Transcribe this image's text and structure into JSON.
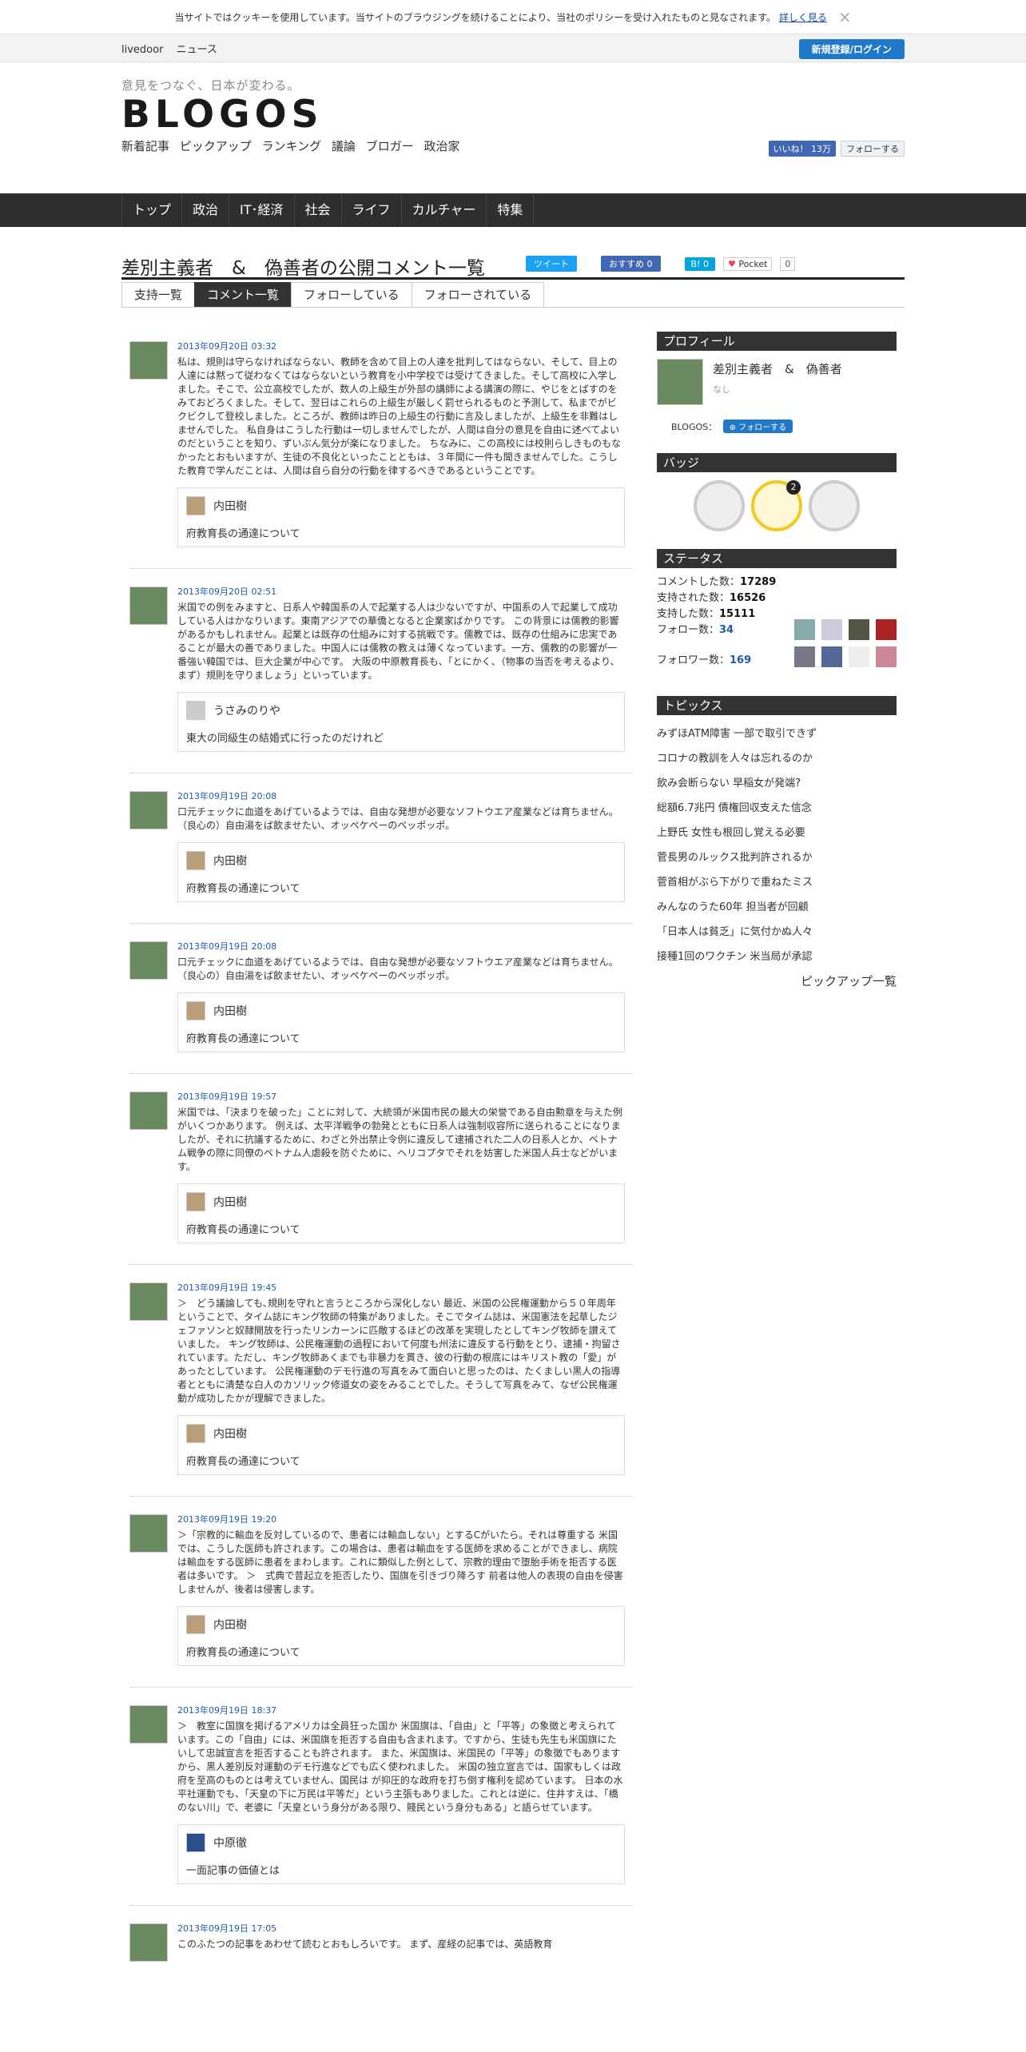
{
  "cookie": {
    "text": "当サイトではクッキーを使用しています。当サイトのブラウジングを続けることにより、当社のポリシーを受け入れたものと見なされます。",
    "more": "詳しく見る",
    "close": "×"
  },
  "topbar": {
    "livedoor": "livedoor",
    "news": "ニュース",
    "login": "新規登録/ログイン"
  },
  "header": {
    "tagline": "意見をつなぐ、日本が変わる。",
    "logo": "BLOGOS",
    "subnav": [
      "新着記事",
      "ピックアップ",
      "ランキング",
      "議論",
      "ブロガー",
      "政治家"
    ],
    "fb_like": "いいね！ 13万",
    "tw_follow": "フォローする"
  },
  "mainnav": [
    "トップ",
    "政治",
    "IT･経済",
    "社会",
    "ライフ",
    "カルチャー",
    "特集"
  ],
  "page": {
    "title": "差別主義者　&　偽善者の公開コメント一覧",
    "share": {
      "tweet": "ツイート",
      "fb": "おすすめ 0",
      "hatena": "B! 0",
      "pocket": "Pocket",
      "pocket_count": "0"
    }
  },
  "tabs": [
    "支持一覧",
    "コメント一覧",
    "フォローしている",
    "フォローされている"
  ],
  "comments": [
    {
      "date": "2013年09月20日 03:32",
      "text": "私は、規則は守らなければならない、教師を含めて目上の人達を批判してはならない、そして、目上の人達には黙って従わなくてはならないという教育を小中学校では受けてきました。そして高校に入学しました。そこで、公立高校でしたが、数人の上級生が外部の講師による講演の際に、やじをとばすのをみておどろくました。そして、翌日はこれらの上級生が厳しく罰せられるものと予測して、私までがビクビクして登校しました。ところが、教師は昨日の上級生の行動に言及しましたが、上級生を非難はしませんでした。 私自身はこうした行動は一切しませんでしたが、人間は自分の意見を自由に述べてよいのだということを知り、ずいぶん気分が楽になりました。 ちなみに、この高校には校則らしきものもなかったとおもいますが、生徒の不良化といったことともは、３年間に一件も聞きませんでした。こうした教育で学んだことは、人間は自ら自分の行動を律するべきであるということです。",
      "user": "内田樹",
      "article": "府教育長の通達について"
    },
    {
      "date": "2013年09月20日 02:51",
      "text": "米国での例をみますと、日系人や韓国系の人で起業する人は少ないですが、中国系の人で起業して成功している人はかなりいます。東南アジアでの華僑となると企業家ばかりです。 この背景には儒教的影響があるかもしれません。起業とは既存の仕組みに対する挑戦です。儒教では、既存の仕組みに忠実であることが最大の善でありました。中国人には儒教の教えは薄くなっています。一方、儒教的の影響が一番強い韓国では、巨大企業が中心です。 大阪の中原教育長も、「とにかく、（物事の当否を考えるより、まず）規則を守りましょう」といっています。",
      "user": "うさみのりや",
      "article": "東大の同級生の結婚式に行ったのだけれど"
    },
    {
      "date": "2013年09月19日 20:08",
      "text": "口元チェックに血道をあげているようでは、自由な発想が必要なソフトウエア産業などは育ちません。 （良心の）自由湯をば飲ませたい、オッペケペーのペッポッポ。",
      "user": "内田樹",
      "article": "府教育長の通達について"
    },
    {
      "date": "2013年09月19日 20:08",
      "text": "口元チェックに血道をあげているようでは、自由な発想が必要なソフトウエア産業などは育ちません。 （良心の）自由湯をば飲ませたい、オッペケペーのペッポッポ。",
      "user": "内田樹",
      "article": "府教育長の通達について"
    },
    {
      "date": "2013年09月19日 19:57",
      "text": "米国では、「決まりを破った」ことに対して、大統領が米国市民の最大の栄誉である自由勲章を与えた例がいくつかあります。 例えば、太平洋戦争の勃発とともに日系人は強制収容所に送られることになりましたが、それに抗議するために、わざと外出禁止令例に違反して逮捕された二人の日系人とか、ベトナム戦争の際に同僚のベトナム人虐殺を防ぐために、ヘリコプタでそれを妨害した米国人兵士などがいます。",
      "user": "内田樹",
      "article": "府教育長の通達について"
    },
    {
      "date": "2013年09月19日 19:45",
      "text": "＞　どう議論しても､規則を守れと言うところから深化しない 最近、米国の公民権運動から５０年周年ということで、タイム誌にキング牧師の特集がありました。そこでタイム誌は、米国憲法を起草したジェファソンと奴隷開放を行ったリンカーンに匹敵するほどの改革を実現したとしてキング牧師を讃えていました。 キング牧師は、公民権運動の過程において何度も州法に違反する行動をとり、逮捕・拘留されています。ただし、キング牧師あくまでも非暴力を貫き、彼の行動の根底にはキリスト教の「愛」があったとしています。 公民権運動のデモ行進の写真をみて面白いと思ったのは、たくましい黒人の指導者とともに清楚な白人のカソリック修道女の姿をみることでした。そうして写真をみて、なぜ公民権運動が成功したかが理解できました。",
      "user": "内田樹",
      "article": "府教育長の通達について"
    },
    {
      "date": "2013年09月19日 19:20",
      "text": "＞「宗教的に輸血を反対しているので、患者には輸血しない」とするCがいたら。それは尊重する 米国では、こうした医師も許されます。この場合は、患者は輸血をする医師を求めることができまし、病院は輸血をする医師に患者をまわします。これに類似した例として、宗教的理由で堕胎手術を拒否する医者は多いです。 ＞　式典で昔起立を拒否したり、国旗を引きづり降ろす 前者は他人の表現の自由を侵害しませんが、後者は侵害します。",
      "user": "内田樹",
      "article": "府教育長の通達について"
    },
    {
      "date": "2013年09月19日 18:37",
      "text": "＞　教室に国旗を掲げるアメリカは全員狂った国か 米国旗は、「自由」と「平等」の象徴と考えられています。この「自由」には、米国旗を拒否する自由も含まれます。ですから、生徒も先生も米国旗にたいして忠誠宣言を拒否することも許されます。 また、米国旗は、米国民の「平等」の象徴でもありますから、黒人差別反対運動のデモ行進などでも広く使われました。 米国の独立宣言では、国家もしくは政府を至高のものとは考えていません、国民は が抑圧的な政府を打ち倒す権利を認めています。 日本の水平社運動でも、「天皇の下に万民は平等だ」という主張もありました。これとは逆に、住井すえは、「橋のない川」で、老婆に「天皇という身分がある限り、賤民という身分もある」と語らせています。",
      "user": "中原徹",
      "article": "一面記事の価値とは"
    },
    {
      "date": "2013年09月19日 17:05",
      "text": "このふたつの記事をあわせて読むとおもしろいです。 まず、産経の記事では、英語教育",
      "user": "",
      "article": ""
    }
  ],
  "sidebar": {
    "profile_title": "プロフィール",
    "profile_name": "差別主義者　&　偽善者",
    "profile_desc": "なし",
    "blogos_label": "BLOGOS：",
    "follow_button": "フォローする",
    "badge_title": "バッジ",
    "badge_count": "2",
    "status_title": "ステータス",
    "stats": {
      "comments_label": "コメントした数：",
      "comments": "17289",
      "supported_label": "支持された数：",
      "supported": "16526",
      "support_label": "支持した数：",
      "support": "15111",
      "follow_label": "フォロー数：",
      "follow": "34",
      "follower_label": "フォロワー数：",
      "follower": "169"
    },
    "topics_title": "トピックス",
    "topics": [
      "みずほATM障害 一部で取引できず",
      "コロナの教訓を人々は忘れるのか",
      "飲み会断らない 早稲女が発端?",
      "総額6.7兆円 債権回収支えた信念",
      "上野氏 女性も根回し覚える必要",
      "菅長男のルックス批判許されるか",
      "菅首相がぶら下がりで重ねたミス",
      "みんなのうた60年 担当者が回顧",
      "「日本人は貧乏」に気付かぬ人々",
      "接種1回のワクチン 米当局が承認"
    ],
    "pickup_all": "ピックアップ一覧"
  }
}
